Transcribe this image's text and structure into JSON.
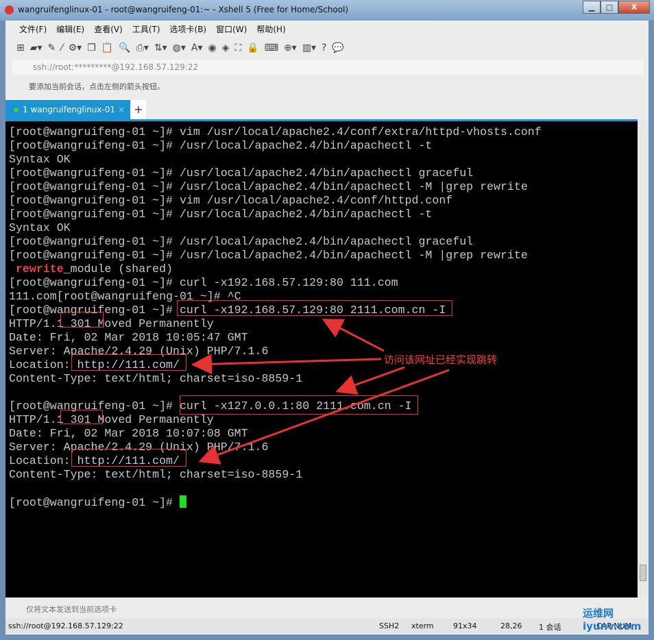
{
  "window": {
    "title": "wangruifenglinux-01 - root@wangruifeng-01:~ - Xshell 5 (Free for Home/School)"
  },
  "menu": [
    "文件(F)",
    "编辑(E)",
    "查看(V)",
    "工具(T)",
    "选项卡(B)",
    "窗口(W)",
    "帮助(H)"
  ],
  "address": "ssh://root:*********@192.168.57.129:22",
  "hint": "要添加当前会话，点击左侧的箭头按钮。",
  "tab": {
    "label": "1 wangruifenglinux-01",
    "close": "×",
    "add": "+"
  },
  "terminal": {
    "prompt": "[root@wangruifeng-01 ~]# ",
    "lines": [
      "[root@wangruifeng-01 ~]# vim /usr/local/apache2.4/conf/extra/httpd-vhosts.conf",
      "[root@wangruifeng-01 ~]# /usr/local/apache2.4/bin/apachectl -t",
      "Syntax OK",
      "[root@wangruifeng-01 ~]# /usr/local/apache2.4/bin/apachectl graceful",
      "[root@wangruifeng-01 ~]# /usr/local/apache2.4/bin/apachectl -M |grep rewrite",
      "[root@wangruifeng-01 ~]# vim /usr/local/apache2.4/conf/httpd.conf",
      "[root@wangruifeng-01 ~]# /usr/local/apache2.4/bin/apachectl -t",
      "Syntax OK",
      "[root@wangruifeng-01 ~]# /usr/local/apache2.4/bin/apachectl graceful",
      "[root@wangruifeng-01 ~]# /usr/local/apache2.4/bin/apachectl -M |grep rewrite",
      "__REWRITE__",
      "[root@wangruifeng-01 ~]# curl -x192.168.57.129:80 111.com",
      "111.com[root@wangruifeng-01 ~]# ^C",
      "[root@wangruifeng-01 ~]# curl -x192.168.57.129:80 2111.com.cn -I",
      "HTTP/1.1 301 Moved Permanently",
      "Date: Fri, 02 Mar 2018 10:05:47 GMT",
      "Server: Apache/2.4.29 (Unix) PHP/7.1.6",
      "Location: http://111.com/",
      "Content-Type: text/html; charset=iso-8859-1",
      "",
      "[root@wangruifeng-01 ~]# curl -x127.0.0.1:80 2111.com.cn -I",
      "HTTP/1.1 301 Moved Permanently",
      "Date: Fri, 02 Mar 2018 10:07:08 GMT",
      "Server: Apache/2.4.29 (Unix) PHP/7.1.6",
      "Location: http://111.com/",
      "Content-Type: text/html; charset=iso-8859-1",
      ""
    ],
    "rewrite_word": "rewrite",
    "rewrite_rest": "_module (shared)"
  },
  "annotation": "访问该网址已经实现跳转",
  "sendbar": "仅将文本发送到当前选项卡",
  "status": {
    "conn": "ssh://root@192.168.57.129:22",
    "proto": "SSH2",
    "term": "xterm",
    "size": "91x34",
    "pos": "28,26",
    "sessions": "1 会话",
    "caps": "CAP NUM"
  },
  "watermark": "运维网 iyunv.com",
  "colors": {
    "accent": "#1c93d3",
    "annotation": "#e53333",
    "cursor": "#22dd22"
  }
}
